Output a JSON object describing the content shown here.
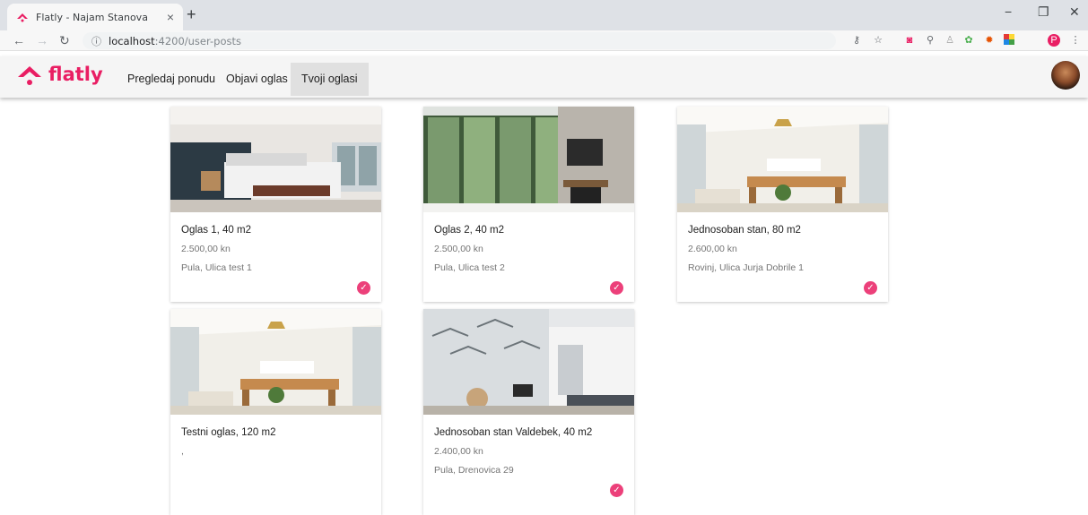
{
  "browser": {
    "tab_title": "Flatly - Najam Stanova",
    "tab_close": "×",
    "new_tab": "+",
    "url_host": "localhost",
    "url_path": ":4200/user-posts",
    "window_controls": [
      "−",
      "❐",
      "✕"
    ]
  },
  "navbar": {
    "logo_text": "flatly",
    "links": [
      "Pregledaj ponudu",
      "Objavi oglas",
      "Tvoji oglasi"
    ],
    "active_link": "Tvoji oglasi"
  },
  "colors": {
    "accent": "#e91e63",
    "check": "#ec407a",
    "navbar_bg": "#f5f5f5"
  },
  "cards": [
    {
      "title": "Oglas 1, 40 m2",
      "price": "2.500,00 kn",
      "address": "Pula, Ulica test 1",
      "checked": true,
      "image": "bedroom"
    },
    {
      "title": "Oglas 2, 40 m2",
      "price": "2.500,00 kn",
      "address": "Pula, Ulica test 2",
      "checked": true,
      "image": "living-room-fireplace"
    },
    {
      "title": "Jednosoban stan, 80 m2",
      "price": "2.600,00 kn",
      "address": "Rovinj, Ulica Jurja Dobrile 1",
      "checked": true,
      "image": "dining-room"
    },
    {
      "title": "Testni oglas, 120 m2",
      "price": "",
      "address": ",",
      "checked": false,
      "image": "dining-room"
    },
    {
      "title": "Jednosoban stan Valdebek, 40 m2",
      "price": "2.400,00 kn",
      "address": "Pula, Drenovica 29",
      "checked": true,
      "image": "studio-apartment"
    }
  ]
}
